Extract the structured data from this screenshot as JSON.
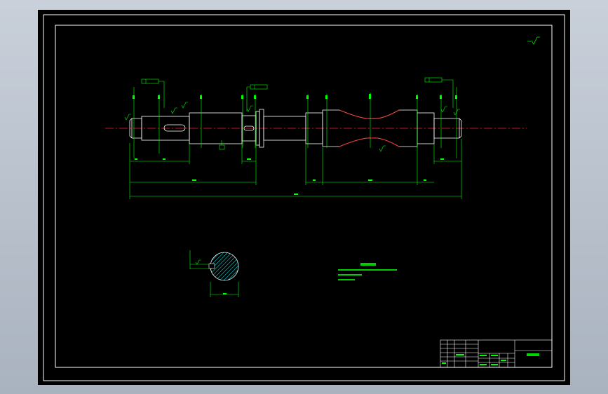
{
  "title_block": {
    "part_name": "",
    "note_heading": "",
    "notes": [
      "",
      "",
      ""
    ]
  },
  "colors": {
    "background": "#000000",
    "frame": "#ffffff",
    "outline": "#ffffff",
    "dimension": "#00ff00",
    "centerline": "#ff2020",
    "callout": "#00ff00",
    "hatch": "#00ffff"
  }
}
